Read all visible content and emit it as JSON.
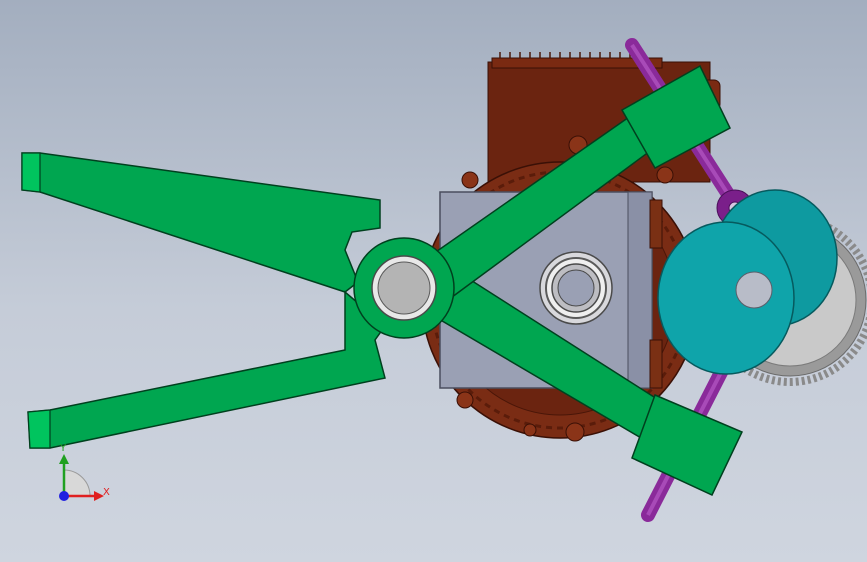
{
  "scene": {
    "colors": {
      "background_top": "#a3aebf",
      "background_bottom": "#cfd5df",
      "gripper_green": "#00a650",
      "gripper_green_dark": "#008a40",
      "motor_body": "#6b2410",
      "motor_fins": "#8a3418",
      "center_block": "#9aa0b4",
      "center_block_side": "#8a90a6",
      "cam_teal": "#0e9aa0",
      "gear_grey": "#9a9a9a",
      "linkage_purple": "#8a2a9a",
      "pivot_grey": "#b4b4b4"
    },
    "components": [
      "gripper-jaw-upper",
      "gripper-jaw-lower",
      "pivot-pin",
      "gear-motor",
      "center-mounting-block",
      "bearing",
      "upper-link-arm",
      "lower-link-arm",
      "cam-disk",
      "spur-gear",
      "actuator-rod"
    ]
  },
  "triad": {
    "x_label": "X",
    "y_label": "Y",
    "x_color": "#e02020",
    "y_color": "#20a020",
    "z_color": "#2020e0"
  }
}
